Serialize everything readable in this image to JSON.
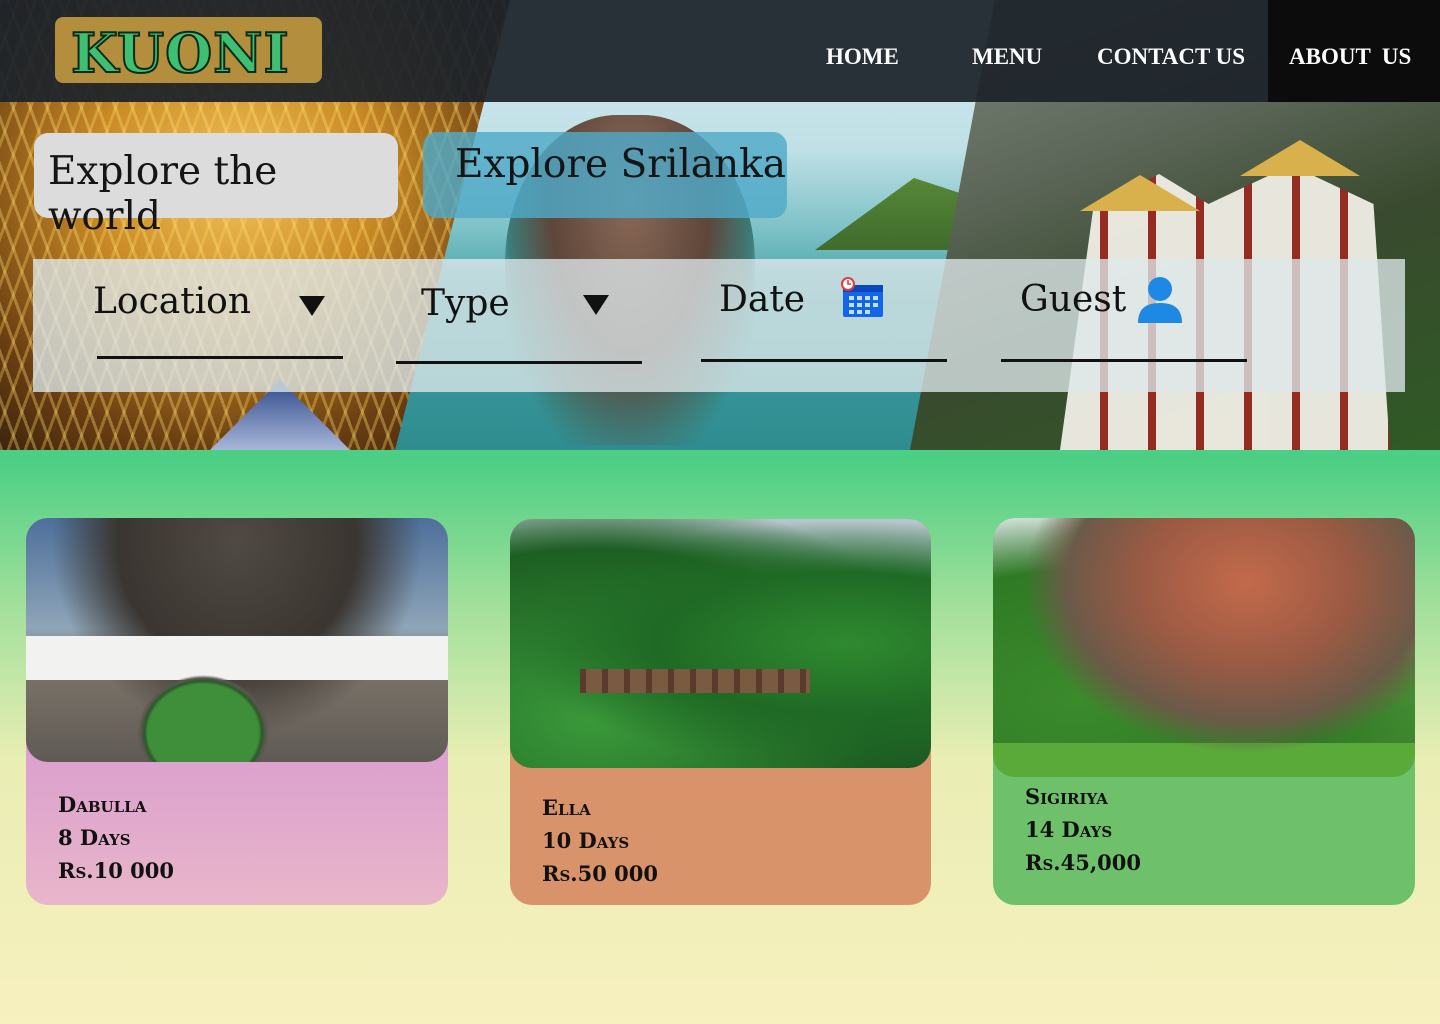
{
  "brand": {
    "logo_text": "KUONI"
  },
  "nav": {
    "items": [
      {
        "label": "HOME"
      },
      {
        "label": "MENU"
      },
      {
        "label": "CONTACT US"
      },
      {
        "label": "ABOUT  US"
      }
    ]
  },
  "hero": {
    "explore_world": "Explore the world",
    "explore_srilanka": "Explore Srilanka"
  },
  "search": {
    "location_label": "Location",
    "type_label": "Type",
    "date_label": "Date",
    "guest_label": "Guest",
    "icons": {
      "location_dropdown": "caret-down-icon",
      "type_dropdown": "caret-down-icon",
      "date": "calendar-icon",
      "guest": "user-icon"
    }
  },
  "tours": [
    {
      "name": "Dabulla",
      "duration": "8 Days",
      "price": "Rs.10 000",
      "card_color": "#c97fd6"
    },
    {
      "name": "Ella",
      "duration": "10 Days",
      "price": "Rs.50 000",
      "card_color": "#d9936a"
    },
    {
      "name": "Sigiriya",
      "duration": "14 Days",
      "price": "Rs.45,000",
      "card_color": "#6ec06a"
    }
  ],
  "colors": {
    "nav_bg": "#1c222a",
    "logo_bg": "#b38f3d",
    "logo_text": "#3fbf72",
    "page_top": "#4ccf84",
    "page_bottom": "#f7f0bf",
    "explore_world_bg": "#dcdcdc",
    "explore_srilanka_bg": "#4faac8"
  }
}
